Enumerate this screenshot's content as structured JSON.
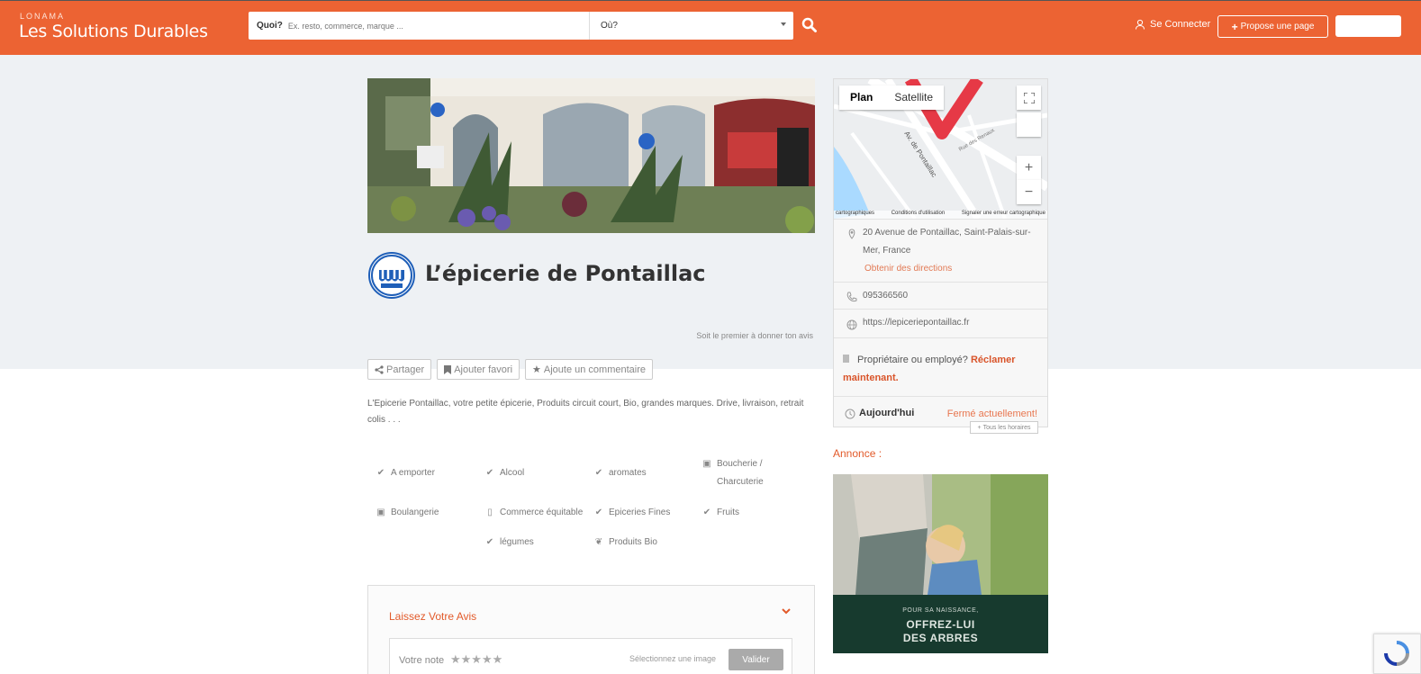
{
  "header": {
    "brand_small": "LONAMA",
    "brand": "Les Solutions Durables",
    "search_what_label": "Quoi?",
    "search_what_placeholder": "Ex. resto, commerce, marque ...",
    "search_where_label": "Où?",
    "login": "Se Connecter",
    "propose": "Propose une page"
  },
  "listing": {
    "title": "L’épicerie de Pontaillac",
    "first_review": "Soit le premier à donner ton avis",
    "actions": [
      "Partager",
      "Ajouter favori",
      "Ajoute un commentaire"
    ],
    "description": "L'Epicerie Pontaillac, votre petite épicerie, Produits circuit court, Bio, grandes marques. Drive, livraison, retrait colis . . .",
    "features": [
      {
        "label": "A emporter",
        "icon": "check-icon"
      },
      {
        "label": "Alcool",
        "icon": "check-icon"
      },
      {
        "label": "aromates",
        "icon": "check-icon"
      },
      {
        "label": "Boucherie / Charcuterie",
        "icon": "person-badge-icon"
      },
      {
        "label": "Boulangerie",
        "icon": "person-badge-icon"
      },
      {
        "label": "Commerce équitable",
        "icon": "mobile-icon"
      },
      {
        "label": "Epiceries Fines",
        "icon": "check-icon"
      },
      {
        "label": "Fruits",
        "icon": "check-icon"
      },
      {
        "label": "légumes",
        "icon": "check-icon"
      },
      {
        "label": "Produits Bio",
        "icon": "leaf-icon"
      }
    ]
  },
  "review": {
    "heading": "Laissez Votre Avis",
    "note_label": "Votre note",
    "stars": "★★★★★",
    "select_image": "Sélectionnez une image",
    "submit": "Valider"
  },
  "map": {
    "tab_plan": "Plan",
    "tab_satellite": "Satellite",
    "footer_left": "cartographiques",
    "footer_mid": "Conditions d'utilisation",
    "footer_right": "Signaler une erreur cartographique",
    "street_1": "Av. de Pontaillac",
    "street_2": "Rue des Renaux"
  },
  "sidebar": {
    "address": "20 Avenue de Pontaillac, Saint-Palais-sur-Mer, France",
    "directions": "Obtenir des directions",
    "phone": "095366560",
    "website": "https://lepiceriepontaillac.fr",
    "claim_prefix": "Propriétaire ou employé?",
    "claim_link": "Réclamer maintenant.",
    "today": "Aujourd'hui",
    "status": "Fermé actuellement!",
    "all_hours": "Tous les horaires"
  },
  "ad": {
    "label": "Annonce :",
    "line1": "POUR SA NAISSANCE,",
    "line2": "OFFREZ-LUI",
    "line3": "DES ARBRES"
  },
  "colors": {
    "accent": "#ec6333",
    "link": "#e27a55"
  }
}
